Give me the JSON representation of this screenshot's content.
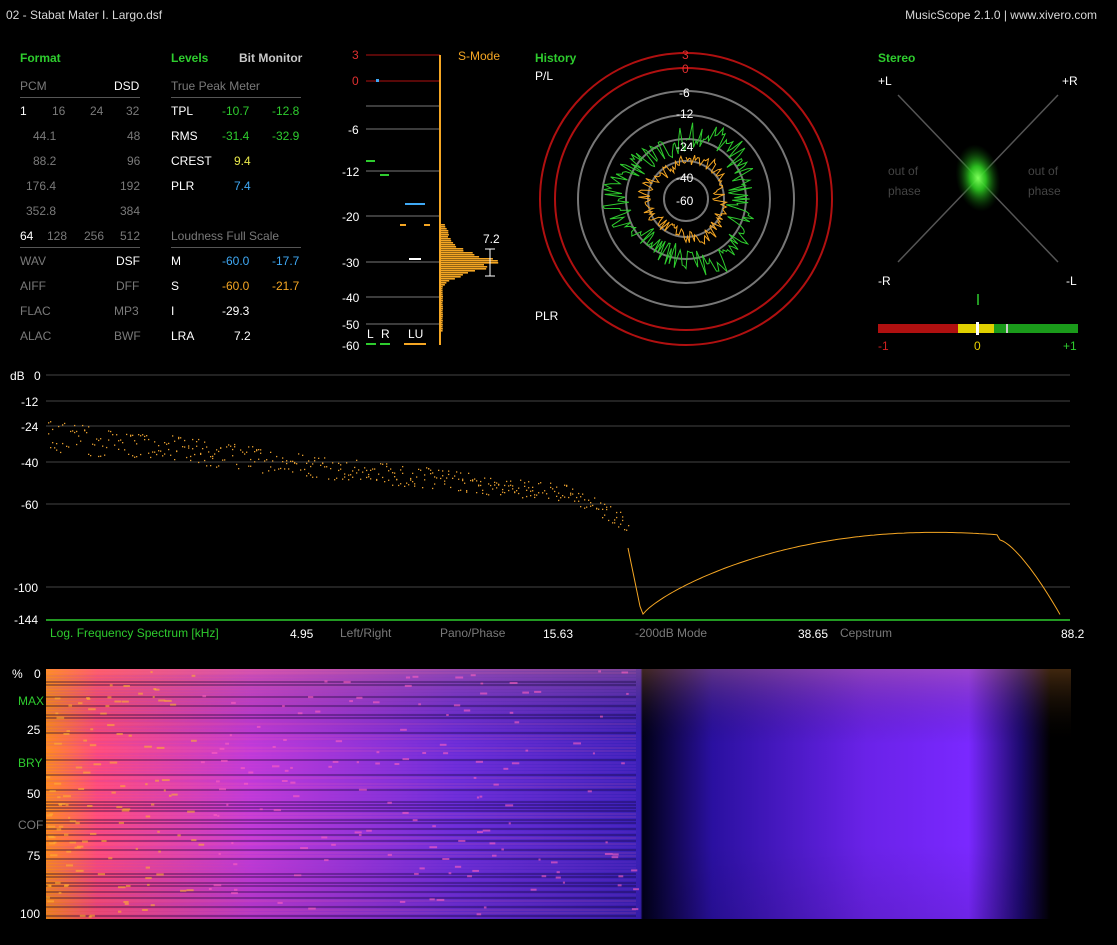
{
  "window": {
    "file_title": "02 - Stabat Mater I. Largo.dsf",
    "app_title": "MusicScope 2.1.0 | www.xivero.com"
  },
  "format": {
    "header": "Format",
    "pcm": "PCM",
    "dsd": "DSD",
    "bits": [
      "1",
      "16",
      "24",
      "32"
    ],
    "rates": [
      [
        "44.1",
        "48"
      ],
      [
        "88.2",
        "96"
      ],
      [
        "176.4",
        "192"
      ],
      [
        "352.8",
        "384"
      ]
    ],
    "dsd_rates": [
      "64",
      "128",
      "256",
      "512"
    ],
    "types": [
      [
        "WAV",
        "DSF"
      ],
      [
        "AIFF",
        "DFF"
      ],
      [
        "FLAC",
        "MP3"
      ],
      [
        "ALAC",
        "BWF"
      ]
    ]
  },
  "levels": {
    "header": "Levels",
    "bit_monitor": "Bit Monitor",
    "true_peak_title": "True Peak Meter",
    "rows": [
      {
        "label": "TPL",
        "l": "-10.7",
        "r": "-12.8"
      },
      {
        "label": "RMS",
        "l": "-31.4",
        "r": "-32.9"
      },
      {
        "label": "CREST",
        "v": "9.4"
      },
      {
        "label": "PLR",
        "v": "7.4"
      }
    ],
    "loudness_title": "Loudness Full Scale",
    "loud": [
      {
        "label": "M",
        "a": "-60.0",
        "b": "-17.7"
      },
      {
        "label": "S",
        "a": "-60.0",
        "b": "-21.7"
      },
      {
        "label": "I",
        "a": "-29.3"
      },
      {
        "label": "LRA",
        "a": "7.2"
      }
    ]
  },
  "meter": {
    "smode": "S-Mode",
    "scale": [
      "3",
      "0",
      "-6",
      "-12",
      "-20",
      "-30",
      "-40",
      "-50",
      "-60"
    ],
    "lra_value": "7.2",
    "bottom_labels": [
      "L",
      "R",
      "LU"
    ]
  },
  "history": {
    "header": "History",
    "pl": "P/L",
    "plr": "PLR",
    "rings": [
      "3",
      "0",
      "-6",
      "-12",
      "-24",
      "-40",
      "-60"
    ]
  },
  "stereo": {
    "header": "Stereo",
    "pl": "+L",
    "pr": "+R",
    "ml": "-R",
    "mr": "-L",
    "oop_left": [
      "out of",
      "phase"
    ],
    "oop_right": [
      "out of",
      "phase"
    ],
    "corr": {
      "min": "-1",
      "mid": "0",
      "max": "+1"
    }
  },
  "spectrum": {
    "unit": "dB",
    "y_ticks": [
      "0",
      "-12",
      "-24",
      "-40",
      "-60",
      "-100",
      "-144"
    ],
    "footer": {
      "title": "Log. Frequency Spectrum [kHz]",
      "f1": "4.95",
      "lr": "Left/Right",
      "pano": "Pano/Phase",
      "f2": "15.63",
      "mode": "-200dB Mode",
      "f3": "38.65",
      "cep": "Cepstrum",
      "f4": "88.2"
    }
  },
  "spectrogram": {
    "unit": "%",
    "labels": [
      "0",
      "MAX",
      "25",
      "BRY",
      "50",
      "COF",
      "75",
      "100"
    ]
  }
}
